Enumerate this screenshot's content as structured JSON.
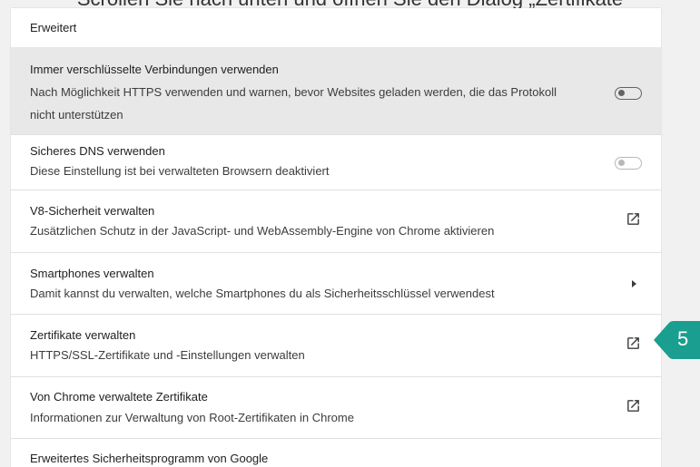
{
  "caption": "Scrollen Sie nach unten und öffnen Sie den Dialog „Zertifikate",
  "section_title": "Erweitert",
  "rows": [
    {
      "title": "Immer verschlüsselte Verbindungen verwenden",
      "line2": "Nach Möglichkeit HTTPS verwenden und warnen, bevor Websites geladen werden, die das Protokoll",
      "line3": "nicht unterstützen",
      "control": "toggle"
    },
    {
      "title": "Sicheres DNS verwenden",
      "line2": "Diese Einstellung ist bei verwalteten Browsern deaktiviert",
      "control": "toggle-disabled"
    },
    {
      "title": "V8-Sicherheit verwalten",
      "line2": "Zusätzlichen Schutz in der JavaScript- und WebAssembly-Engine von Chrome aktivieren",
      "control": "open-in-new-icon"
    },
    {
      "title": "Smartphones verwalten",
      "line2": "Damit kannst du verwalten, welche Smartphones du als Sicherheitsschlüssel verwendest",
      "control": "arrow-right-icon"
    },
    {
      "title": "Zertifikate verwalten",
      "line2": "HTTPS/SSL-Zertifikate und -Einstellungen verwalten",
      "control": "open-in-new-icon"
    },
    {
      "title": "Von Chrome verwaltete Zertifikate",
      "line2": "Informationen zur Verwaltung von Root-Zertifikaten in Chrome",
      "control": "open-in-new-icon"
    },
    {
      "title": "Erweitertes Sicherheitsprogramm von Google",
      "line2": "",
      "control": "none"
    }
  ],
  "callout": {
    "label": "5",
    "color": "#1a9e8f"
  }
}
